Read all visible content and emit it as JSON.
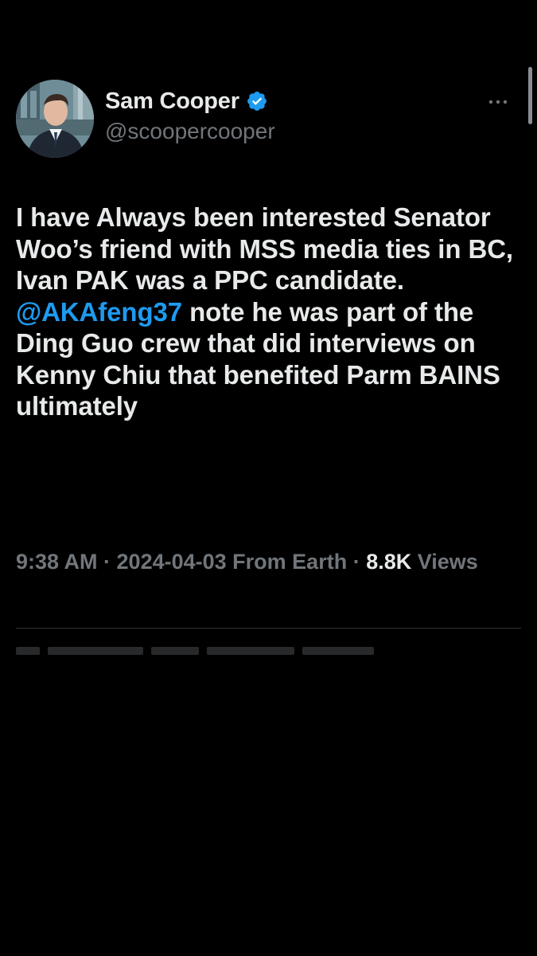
{
  "tweet": {
    "author": {
      "name": "Sam Cooper",
      "handle": "@scoopercooper",
      "verified": true
    },
    "text_segments": [
      "I have Always been interested Senator Woo’s friend with MSS media ties in BC, Ivan PAK was a PPC candidate. ",
      "@AKAfeng37",
      " note he was part of the Ding Guo crew that did interviews on Kenny Chiu that benefited Parm BAINS ultimately"
    ],
    "meta": {
      "time": "9:38 AM",
      "separator": " · ",
      "date": "2024-04-03",
      "source": "From Earth",
      "views_count": "8.8K",
      "views_label": "Views"
    }
  },
  "icons": {
    "verified": "verified-badge-icon",
    "more": "more-options-icon"
  },
  "colors": {
    "background": "#000000",
    "primary_text": "#e7e9ea",
    "secondary_text": "#71767b",
    "accent": "#1d9bf0",
    "divider": "#2f3336"
  }
}
